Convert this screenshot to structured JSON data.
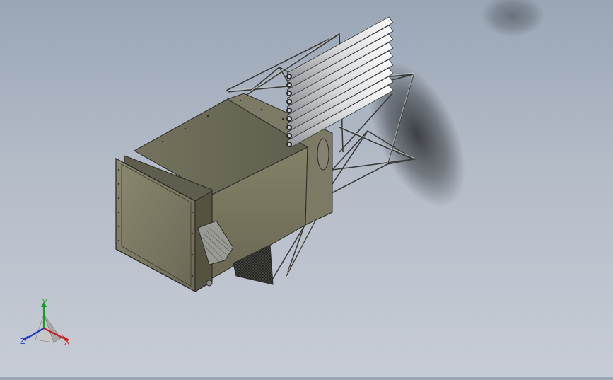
{
  "viewport": {
    "model": "ventilation-duct-with-pipe-rack",
    "colors": {
      "background_top": "#9aa6b6",
      "background_bottom": "#c7ccd5",
      "body_gray": "#7d7b66",
      "frame_metal": "#b7b9b8",
      "pipe": "#e9eaec",
      "outline": "#2b2b2b"
    }
  },
  "triad": {
    "x_label": "X",
    "y_label": "Y",
    "z_label": "Z",
    "x_color": "#d21b1b",
    "y_color": "#1f9a2a",
    "z_color": "#1d3cc4"
  }
}
